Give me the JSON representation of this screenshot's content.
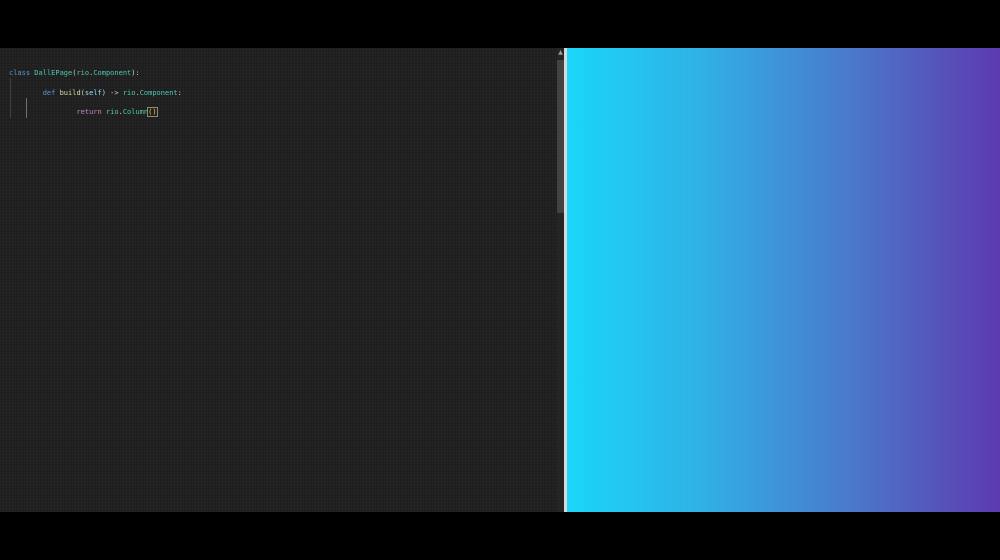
{
  "editor": {
    "lines": [
      {
        "tokens": [
          {
            "text": "class",
            "kind": "keyword"
          },
          {
            "text": " "
          },
          {
            "text": "DallEPage",
            "kind": "class-name"
          },
          {
            "text": "("
          },
          {
            "text": "rio",
            "kind": "class-name"
          },
          {
            "text": "."
          },
          {
            "text": "Component",
            "kind": "class-name"
          },
          {
            "text": "):"
          }
        ]
      },
      {
        "tokens": [
          {
            "text": "def",
            "kind": "keyword"
          },
          {
            "text": " "
          },
          {
            "text": "build",
            "kind": "function"
          },
          {
            "text": "("
          },
          {
            "text": "self",
            "kind": "parameter"
          },
          {
            "text": ") -> "
          },
          {
            "text": "rio",
            "kind": "class-name"
          },
          {
            "text": "."
          },
          {
            "text": "Component",
            "kind": "class-name"
          },
          {
            "text": ":"
          }
        ]
      },
      {
        "tokens": [
          {
            "text": "return",
            "kind": "control"
          },
          {
            "text": " "
          },
          {
            "text": "rio",
            "kind": "class-name"
          },
          {
            "text": "."
          },
          {
            "text": "Column",
            "kind": "class-name"
          },
          {
            "text": "()",
            "kind": "bracket"
          }
        ]
      }
    ],
    "scroll_up_glyph": "▲"
  },
  "colors": {
    "editor_background": "#1e1e1e",
    "keyword": "#569cd6",
    "class_name": "#4ec9b0",
    "function": "#dcdcaa",
    "parameter": "#9cdcfe",
    "control": "#c586c0",
    "bracket_match": "#ffd700",
    "preview_gradient_start": "#1ad6f8",
    "preview_gradient_end": "#5d3ab0"
  }
}
